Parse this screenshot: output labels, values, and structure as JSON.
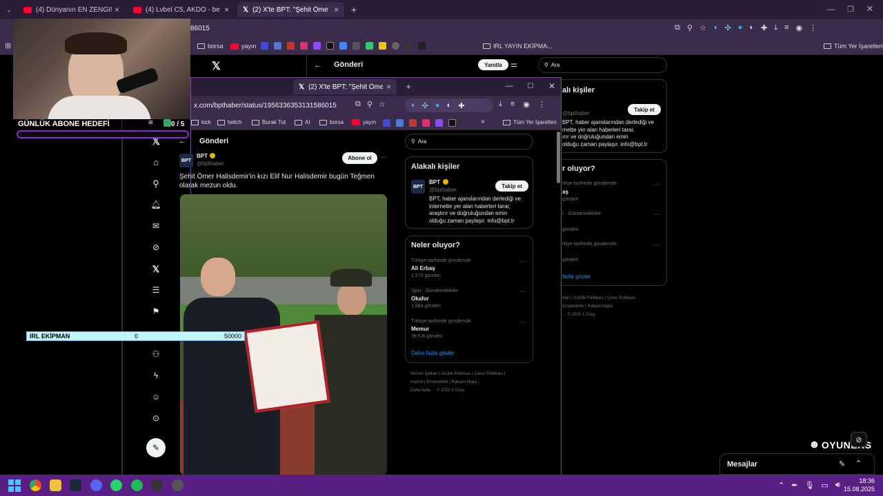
{
  "back_browser": {
    "tabs": [
      {
        "label": "(4) Dünyanın EN ZENGİN ÜLKES"
      },
      {
        "label": "(4) Lvbel C5, AKDO - behzat ç"
      },
      {
        "label": "(2) X'te BPT: \"Şehit Ömer Halisd"
      }
    ],
    "url_fragment": "86015",
    "bookmarks": [
      "borsa",
      "yayın",
      "IRL YAYIN EKİPMA..."
    ],
    "all_bookmarks": "Tüm Yer İşaretleri"
  },
  "back_page": {
    "header_title": "Gönderi",
    "reply_button": "Yanıtla",
    "search_placeholder": "Ara",
    "related": {
      "title_partial": "alı kişiler",
      "handle": "@bpthaber",
      "follow": "Takip et",
      "bio_lines": [
        "BPT, haber ajanslarından derlediği ve",
        "rnette yer alan haberleri tarar,",
        "BPT, haber ajanslarından derlediği ve",
        "internette yer alan haberleri tarar,"
      ],
      "bio": [
        "BPT, haber ajanslarından derlediği ve",
        "rnette yer alan haberleri tarar,",
        "ırır ve doğruluğundan emin",
        "olduğu zaman paylaşır. info@bpt.tr"
      ]
    },
    "trends": {
      "title_partial": "r oluyor?",
      "items": [
        {
          "context": "rkiye tarihinde gündemde",
          "name": "aş",
          "count": "gönderi"
        },
        {
          "context": "r · Gündemdekiler",
          "name": "",
          "count": "gönderi"
        },
        {
          "context": "rkiye tarihinde gündemde",
          "name": "",
          "count": "gönderi"
        }
      ],
      "show_more": "fazla göster"
    },
    "footer": [
      "rtları",
      "Gizlilik Politikası",
      "Çerez Politikası",
      "Erişilebilirlik",
      "Reklam bilgisi",
      "© 2025 X Corp."
    ]
  },
  "front_browser": {
    "tab_label": "(2) X'te BPT: \"Şehit Ömer Halisd",
    "url": "x.com/bpthaber/status/1956336353131586015",
    "bookmarks": [
      "kick",
      "twitch",
      "Burak Tut",
      "AI",
      "borsa",
      "yayın"
    ],
    "more": "»",
    "all_bookmarks": "Tüm Yer İşaretleri"
  },
  "post": {
    "header_title": "Gönderi",
    "author": "BPT",
    "handle": "@bpthaber",
    "subscribe": "Abone ol",
    "text": "Şehit Ömer Halisdemir'in kızı Elif Nur Halisdemir bugün Teğmen olarak mezun oldu."
  },
  "sidebar": {
    "search_placeholder": "Ara",
    "related_title": "Alakalı kişiler",
    "related_name": "BPT",
    "related_handle": "@bpthaber",
    "follow": "Takip et",
    "bio": [
      "BPT, haber ajanslarından derlediği ve",
      "internette yer alan haberleri tarar,",
      "araştırır ve doğruluğundan emin",
      "olduğu zaman paylaşır. info@bpt.tr"
    ],
    "trends_title": "Neler oluyor?",
    "trends": [
      {
        "context": "Türkiye tarihinde gündemde",
        "name": "Ali Erbaş",
        "count": "1.573 gönderi"
      },
      {
        "context": "Spor · Gündemdekiler",
        "name": "Okafor",
        "count": "1.564 gönderi"
      },
      {
        "context": "Türkiye tarihinde gündemde",
        "name": "Memur",
        "count": "39,5 B gönderi"
      }
    ],
    "show_more": "Daha fazla göster",
    "footer_row1": [
      "Hizmet Şartları",
      "Gizlilik Politikası",
      "Çerez Politikası"
    ],
    "footer_row2": [
      "Imprint",
      "Erişilebilirlik",
      "Reklam bilgisi"
    ],
    "footer_row3": [
      "Daha fazla ···",
      "© 2025 X Corp."
    ]
  },
  "overlay": {
    "goal_label": "GÜNLÜK ABONE HEDEFİ",
    "goal_count": "0 / 5",
    "irl_label": "IRL EKİPMAN",
    "irl_current": "0",
    "irl_target": "50000",
    "irl_progress": 0,
    "brand": "OYUNEKS"
  },
  "messages": {
    "label": "Mesajlar"
  },
  "taskbar": {
    "time": "18:36",
    "date": "15.08.2025"
  },
  "colors": {
    "accent": "#1d9bf0",
    "overlay_purple": "#8b2fc9",
    "taskbar": "#5a1f85",
    "progress": "#bff5fb"
  }
}
